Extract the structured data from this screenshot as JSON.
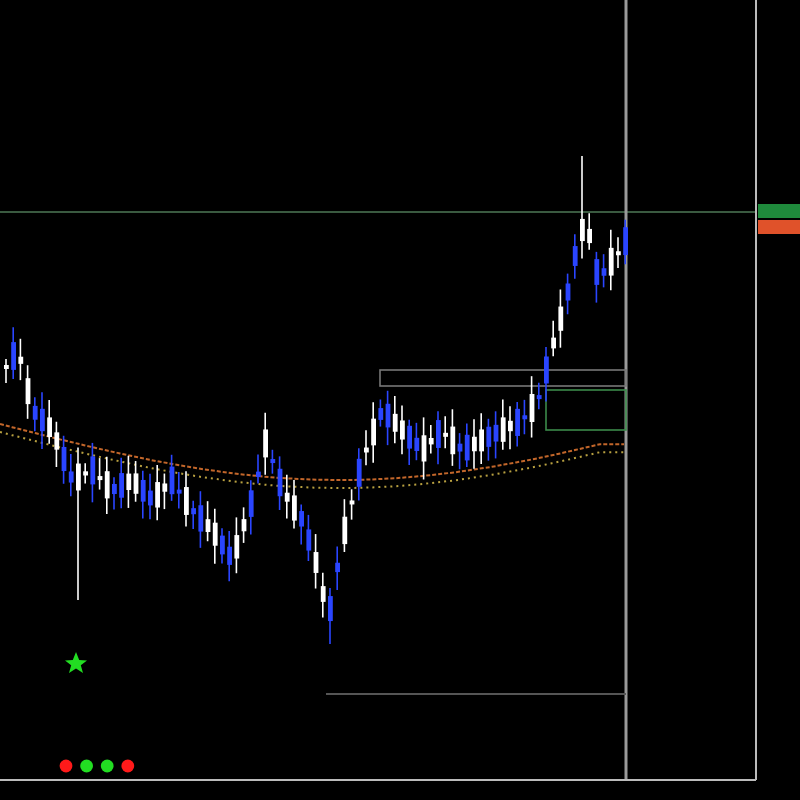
{
  "indicator_dots": [
    {
      "color": "#ff1a1a"
    },
    {
      "color": "#22dd22"
    },
    {
      "color": "#22dd22"
    },
    {
      "color": "#ff1a1a"
    }
  ],
  "price_tags": [
    {
      "color": "#1f8a3c"
    },
    {
      "color": "#e0522a"
    }
  ]
}
